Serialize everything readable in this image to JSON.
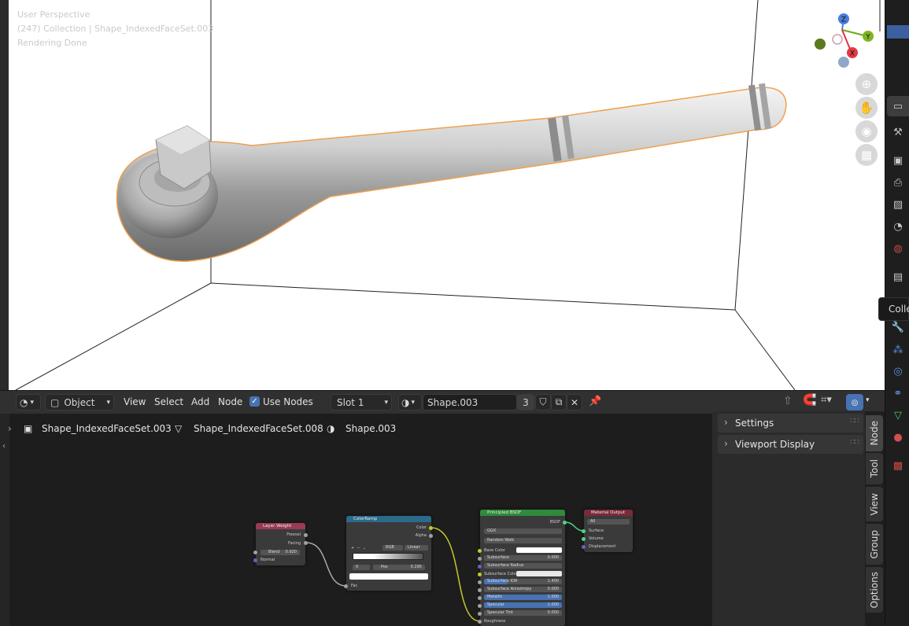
{
  "viewport": {
    "info_lines": [
      "User Perspective",
      "(247) Collection | Shape_IndexedFaceSet.003",
      "Rendering Done"
    ],
    "gizmo_axes": [
      "Z",
      "Y",
      "X"
    ],
    "nav_icons": [
      "zoom-icon",
      "hand-icon",
      "camera-icon",
      "grid-icon"
    ]
  },
  "properties_tabs": [
    "tool-icon",
    "render-icon",
    "output-icon",
    "view-layer-icon",
    "scene-icon",
    "world-icon",
    "collection-icon",
    "modifier-icon",
    "particles-icon",
    "physics-icon",
    "constraints-icon",
    "data-icon",
    "material-icon",
    "texture-icon"
  ],
  "tooltip": "Colle",
  "node_header": {
    "object_mode": "Object",
    "menus": [
      "View",
      "Select",
      "Add",
      "Node"
    ],
    "use_nodes_label": "Use Nodes",
    "use_nodes_checked": true,
    "slot": "Slot 1",
    "material_name": "Shape.003",
    "user_count": "3"
  },
  "breadcrumb": [
    "Shape_IndexedFaceSet.003",
    "Shape_IndexedFaceSet.008",
    "Shape.003"
  ],
  "sidebar": {
    "panels": [
      "Settings",
      "Viewport Display"
    ],
    "tabs": [
      "Node",
      "Tool",
      "View",
      "Group",
      "Options"
    ]
  },
  "nodes": {
    "layer_weight": {
      "title": "Layer Weight",
      "outputs": [
        "Fresnel",
        "Facing"
      ],
      "blend_label": "Blend",
      "blend_value": "0.920",
      "inputs": [
        "Normal"
      ]
    },
    "color_ramp": {
      "title": "ColorRamp",
      "outputs": [
        "Color",
        "Alpha"
      ],
      "mode": "RGB",
      "interp": "Linear",
      "index": "0",
      "pos_label": "Pos",
      "pos_value": "0.295",
      "input": "Fac"
    },
    "principled": {
      "title": "Principled BSDF",
      "output": "BSDF",
      "distribution": "GGX",
      "subsurface_method": "Random Walk",
      "rows": [
        {
          "label": "Base Color",
          "value": ""
        },
        {
          "label": "Subsurface",
          "value": "0.000"
        },
        {
          "label": "Subsurface Radius",
          "value": ""
        },
        {
          "label": "Subsurface Colo",
          "value": ""
        },
        {
          "label": "Subsurface IOR",
          "value": "1.400"
        },
        {
          "label": "Subsurface Anisotropy",
          "value": "0.000"
        },
        {
          "label": "Metallic",
          "value": "1.000"
        },
        {
          "label": "Specular",
          "value": "1.000"
        },
        {
          "label": "Specular Tint",
          "value": "0.000"
        },
        {
          "label": "Roughness",
          "value": ""
        }
      ]
    },
    "material_output": {
      "title": "Material Output",
      "target": "All",
      "inputs": [
        "Surface",
        "Volume",
        "Displacement"
      ]
    }
  },
  "colors": {
    "accent": "#4772b3",
    "selection_outline": "#f0a050",
    "node_converter": "#9b3a55",
    "node_colorramp": "#2a6a8a",
    "node_shader": "#2f8a3a",
    "node_output": "#7a2a3a"
  }
}
